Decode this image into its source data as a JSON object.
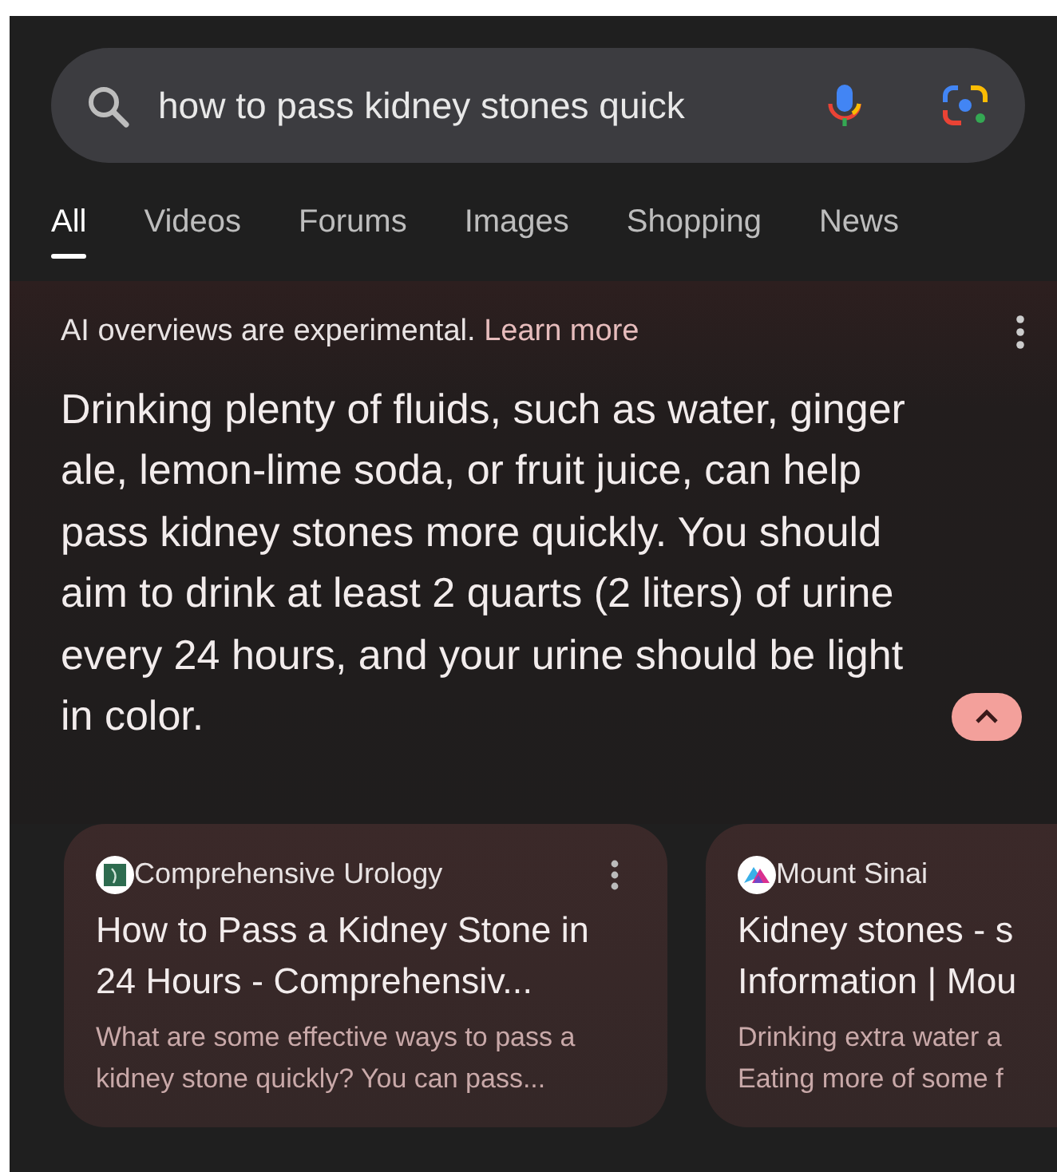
{
  "search": {
    "value": "how to pass kidney stones quick"
  },
  "tabs": [
    {
      "label": "All",
      "selected": true
    },
    {
      "label": "Videos",
      "selected": false
    },
    {
      "label": "Forums",
      "selected": false
    },
    {
      "label": "Images",
      "selected": false
    },
    {
      "label": "Shopping",
      "selected": false
    },
    {
      "label": "News",
      "selected": false
    }
  ],
  "ai_overview": {
    "notice": "AI overviews are experimental.",
    "link": "Learn more",
    "summary": "Drinking plenty of fluids, such as water, ginger ale, lemon-lime soda, or fruit juice, can help pass kidney stones more quickly. You should aim to drink at least 2 quarts (2 liters) of urine every 24 hours, and your urine should be light in color.",
    "expanded": true
  },
  "sources": [
    {
      "kind": "urology",
      "site": "Comprehensive Urology",
      "title": "How to Pass a Kidney Stone in 24 Hours - Comprehensiv...",
      "snippet": "What are some effective ways to pass a kidney stone quickly? You can pass...",
      "menu": true
    },
    {
      "kind": "sinai",
      "site": "Mount Sinai",
      "title": [
        "Kidney stones - s",
        "Information | Mou"
      ],
      "snippet": [
        "Drinking extra water a",
        "Eating more of some f"
      ],
      "menu": false
    }
  ]
}
